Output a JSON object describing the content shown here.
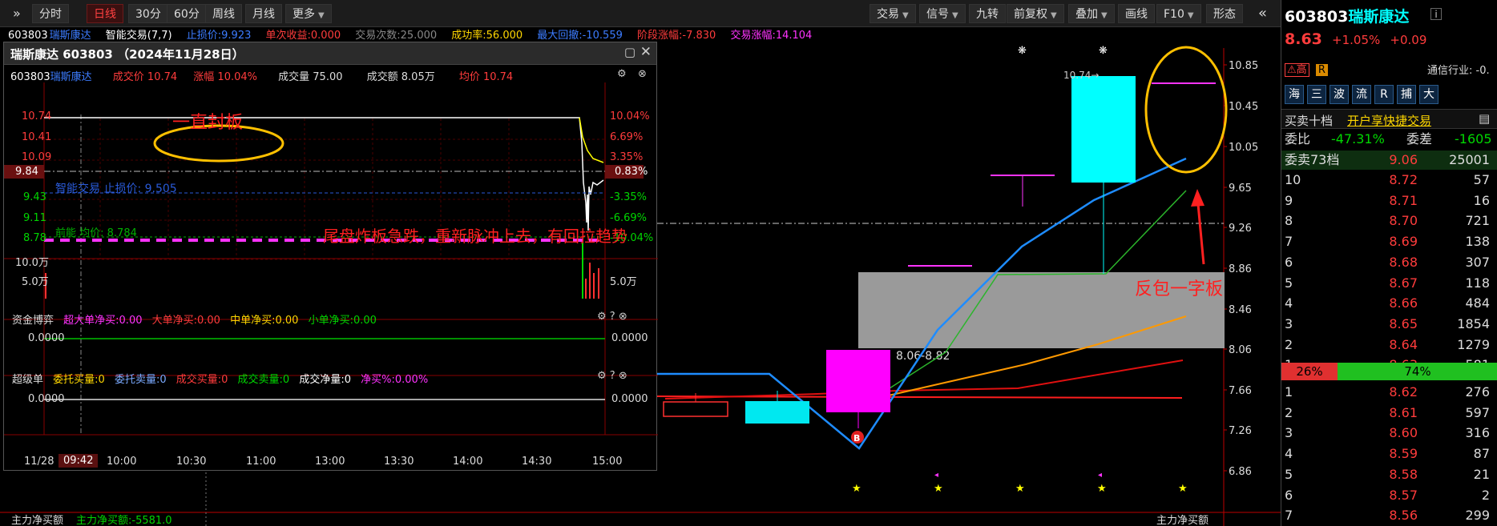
{
  "toolbar": {
    "menu_label": "»",
    "periods": [
      "分时",
      "日线",
      "30分",
      "60分",
      "周线",
      "月线",
      "更多"
    ],
    "active_period": "日线",
    "right": [
      "交易",
      "信号",
      "九转",
      "前复权",
      "叠加",
      "画线",
      "F10",
      "形态"
    ],
    "collapse": "«"
  },
  "infoline": {
    "code": "603803",
    "name": "瑞斯康达",
    "indicator": "智能交易(7,7)",
    "stop_loss": "止损价:9.923",
    "last_gain": "单次收益:0.000",
    "trade_count": "交易次数:25.000",
    "win_rate": "成功率:56.000",
    "max_drawdown": "最大回撤:-10.559",
    "stage_gain": "阶段涨幅:-7.830",
    "trade_gain": "交易涨幅:14.104"
  },
  "popup": {
    "title": "瑞斯康达 603803 （2024年11月28日）",
    "quote_code": "603803",
    "quote_name": "瑞斯康达",
    "price": "成交价 10.74",
    "change": "涨幅 10.04%",
    "volume": "成交量 75.00",
    "amount": "成交额 8.05万",
    "avg": "均价 10.74",
    "left_ticks": [
      "10.74",
      "10.41",
      "10.09",
      "9.84",
      "9.43",
      "9.11",
      "8.78",
      "10.0万",
      "5.0万"
    ],
    "right_ticks": [
      "10.04%",
      "6.69%",
      "3.35%",
      "0.83%",
      "-3.35%",
      "-6.69%",
      "-10.04%",
      "5.0万"
    ],
    "annotation1": "一直封板",
    "stop_label": "智能交易 止损价:  9.505",
    "stop_label2": "前能 均价:  8.784",
    "annotation2": "尾盘炸板急跌，重新脉冲上去，有回拉趋势",
    "fund_title": "资金博弈",
    "fund_items": [
      "超大单净买:0.00",
      "大单净买:0.00",
      "中单净买:0.00",
      "小单净买:0.00"
    ],
    "fund_zero": "0.0000",
    "super_title": "超级单",
    "super_items": [
      "委托买量:0",
      "委托卖量:0",
      "成交买量:0",
      "成交卖量:0",
      "成交净量:0",
      "净买%:0.00%"
    ],
    "super_zero": "0.0000",
    "time_date": "11/28",
    "time_cursor": "09:42",
    "time_ticks": [
      "10:00",
      "10:30",
      "11:00",
      "13:00",
      "13:30",
      "14:00",
      "14:30",
      "15:00"
    ]
  },
  "chart": {
    "price_axis": [
      "10.85",
      "10.45",
      "10.05",
      "9.65",
      "9.26",
      "8.86",
      "8.46",
      "8.06",
      "7.66",
      "7.26",
      "6.86"
    ],
    "high_label": "10.74→",
    "range_label": "8.06-8.82",
    "b_marker": "B",
    "annotation3": "反包一字板",
    "bottom_left": "主力净买额",
    "bottom_value": "主力净买额:-5581.0",
    "bottom_right": "主力净买额"
  },
  "rpanel": {
    "code": "603803",
    "name": "瑞斯康达",
    "price": "8.63",
    "pct": "+1.05%",
    "chg": "+0.09",
    "tag_high": "高",
    "tag_r": "R",
    "industry": "通信行业: -0.",
    "tabs": [
      "海",
      "三",
      "波",
      "流",
      "R",
      "捕",
      "大"
    ],
    "book_title": "买卖十档",
    "book_link": "开户享快捷交易",
    "ratio_label": "委比",
    "ratio": "-47.31%",
    "diff_label": "委差",
    "diff": "-1605",
    "ask_summary": [
      "委卖73档",
      "9.06",
      "25001"
    ],
    "asks": [
      [
        "10",
        "8.72",
        "57"
      ],
      [
        "9",
        "8.71",
        "16"
      ],
      [
        "8",
        "8.70",
        "721"
      ],
      [
        "7",
        "8.69",
        "138"
      ],
      [
        "6",
        "8.68",
        "307"
      ],
      [
        "5",
        "8.67",
        "118"
      ],
      [
        "4",
        "8.66",
        "484"
      ],
      [
        "3",
        "8.65",
        "1854"
      ],
      [
        "2",
        "8.64",
        "1279"
      ],
      [
        "1",
        "8.63",
        "581"
      ]
    ],
    "bar_left": "26%",
    "bar_right": "74%",
    "bids": [
      [
        "1",
        "8.62",
        "276"
      ],
      [
        "2",
        "8.61",
        "597"
      ],
      [
        "3",
        "8.60",
        "316"
      ],
      [
        "4",
        "8.59",
        "87"
      ],
      [
        "5",
        "8.58",
        "21"
      ],
      [
        "6",
        "8.57",
        "2"
      ],
      [
        "7",
        "8.56",
        "299"
      ]
    ]
  },
  "colors": {
    "up": "#ff3c3c",
    "down": "#00d600",
    "cyan": "#00ffff",
    "magenta": "#ff00ff",
    "annot": "#ff2020",
    "ellipse": "#ffc000"
  }
}
